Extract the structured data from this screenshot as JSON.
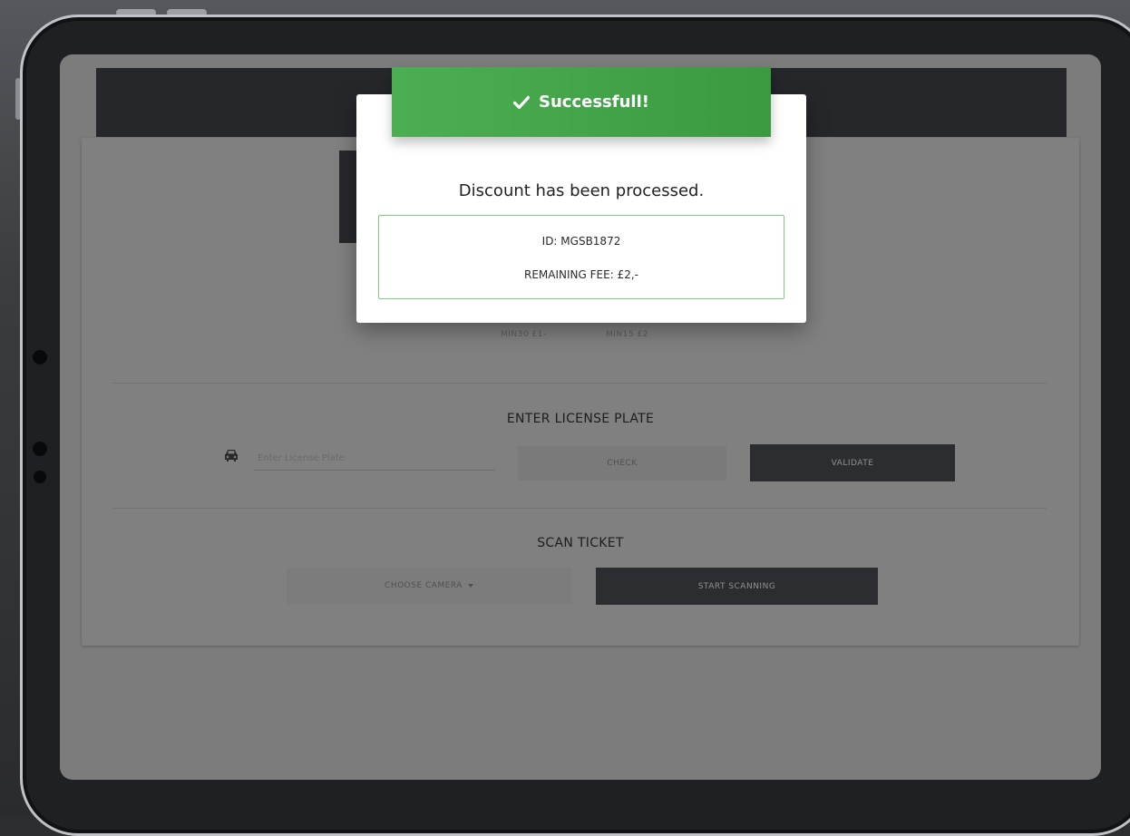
{
  "modal": {
    "title": "Successfull!",
    "message": "Discount has been processed.",
    "id_line": "ID: MGSB1872",
    "fee_line": "REMAINING FEE: £2,-",
    "accent_color": "#4cae52"
  },
  "discount_options": [
    "MIN30 £1-",
    "MIN15 £2"
  ],
  "license": {
    "title": "ENTER LICENSE PLATE",
    "placeholder": "Enter License Plate",
    "check_label": "CHECK",
    "validate_label": "VALIDATE",
    "icon": "car-icon"
  },
  "scan": {
    "title": "SCAN TICKET",
    "camera_label": "CHOOSE CAMERA",
    "start_label": "START SCANNING"
  }
}
